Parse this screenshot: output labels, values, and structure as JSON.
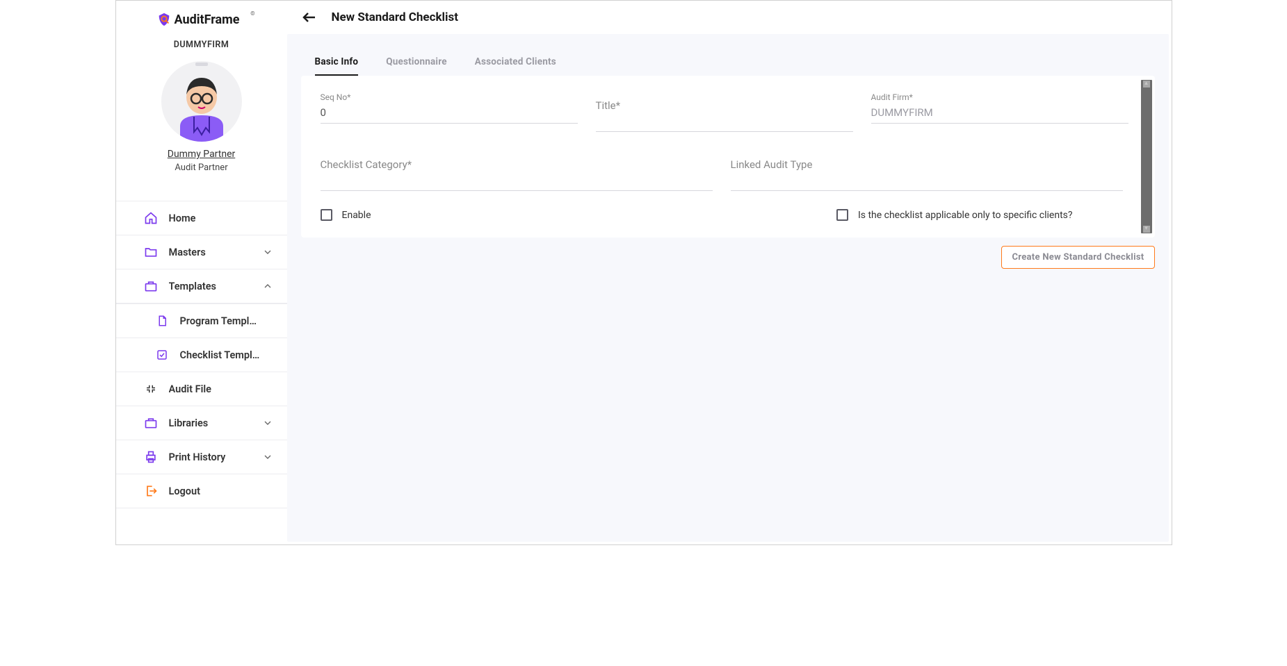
{
  "brand": {
    "name": "AuditFrame"
  },
  "firm": {
    "name": "DUMMYFIRM",
    "user_name": "Dummy Partner",
    "user_role": "Audit Partner"
  },
  "nav": {
    "home": "Home",
    "masters": "Masters",
    "templates": "Templates",
    "program_templates": "Program Templ…",
    "checklist_templates": "Checklist Templ…",
    "audit_file": "Audit File",
    "libraries": "Libraries",
    "print_history": "Print History",
    "logout": "Logout"
  },
  "page": {
    "title": "New Standard Checklist"
  },
  "tabs": {
    "basic_info": "Basic Info",
    "questionnaire": "Questionnaire",
    "associated_clients": "Associated Clients"
  },
  "form": {
    "seq_no_label": "Seq No*",
    "seq_no_value": "0",
    "title_label": "Title*",
    "title_value": "",
    "audit_firm_label": "Audit Firm*",
    "audit_firm_value": "DUMMYFIRM",
    "checklist_category_label": "Checklist Category*",
    "checklist_category_value": "",
    "linked_audit_type_label": "Linked Audit Type",
    "linked_audit_type_value": "",
    "enable_label": "Enable",
    "specific_clients_label": "Is the checklist applicable only to specific clients?"
  },
  "actions": {
    "create_button": "Create New Standard Checklist"
  }
}
